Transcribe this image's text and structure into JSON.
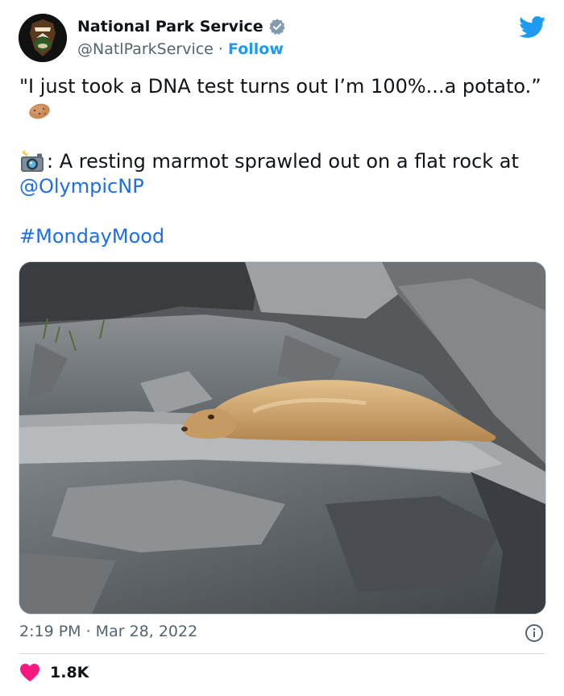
{
  "account": {
    "display_name": "National Park Service",
    "handle": "@NatlParkService",
    "separator": " · ",
    "follow_label": "Follow",
    "verified": true,
    "avatar_icon": "nps-arrowhead-logo"
  },
  "tweet": {
    "line1_text": "\"I just took a DNA test turns out I’m 100%...a potato.”",
    "line1_emoji": "potato-icon",
    "line2_prefix": ": A resting marmot sprawled out on a flat rock at ",
    "line2_emoji": "camera-flash-icon",
    "mention": "@OlympicNP",
    "hashtag": "#MondayMood",
    "image_alt": "marmot resting on rock"
  },
  "meta": {
    "timestamp": "2:19 PM · Mar 28, 2022",
    "like_count": "1.8K"
  },
  "colors": {
    "brand_blue": "#1d9bf0",
    "link_blue": "#1d6ee8",
    "heart_red": "#f91880",
    "text_secondary": "#536471"
  }
}
